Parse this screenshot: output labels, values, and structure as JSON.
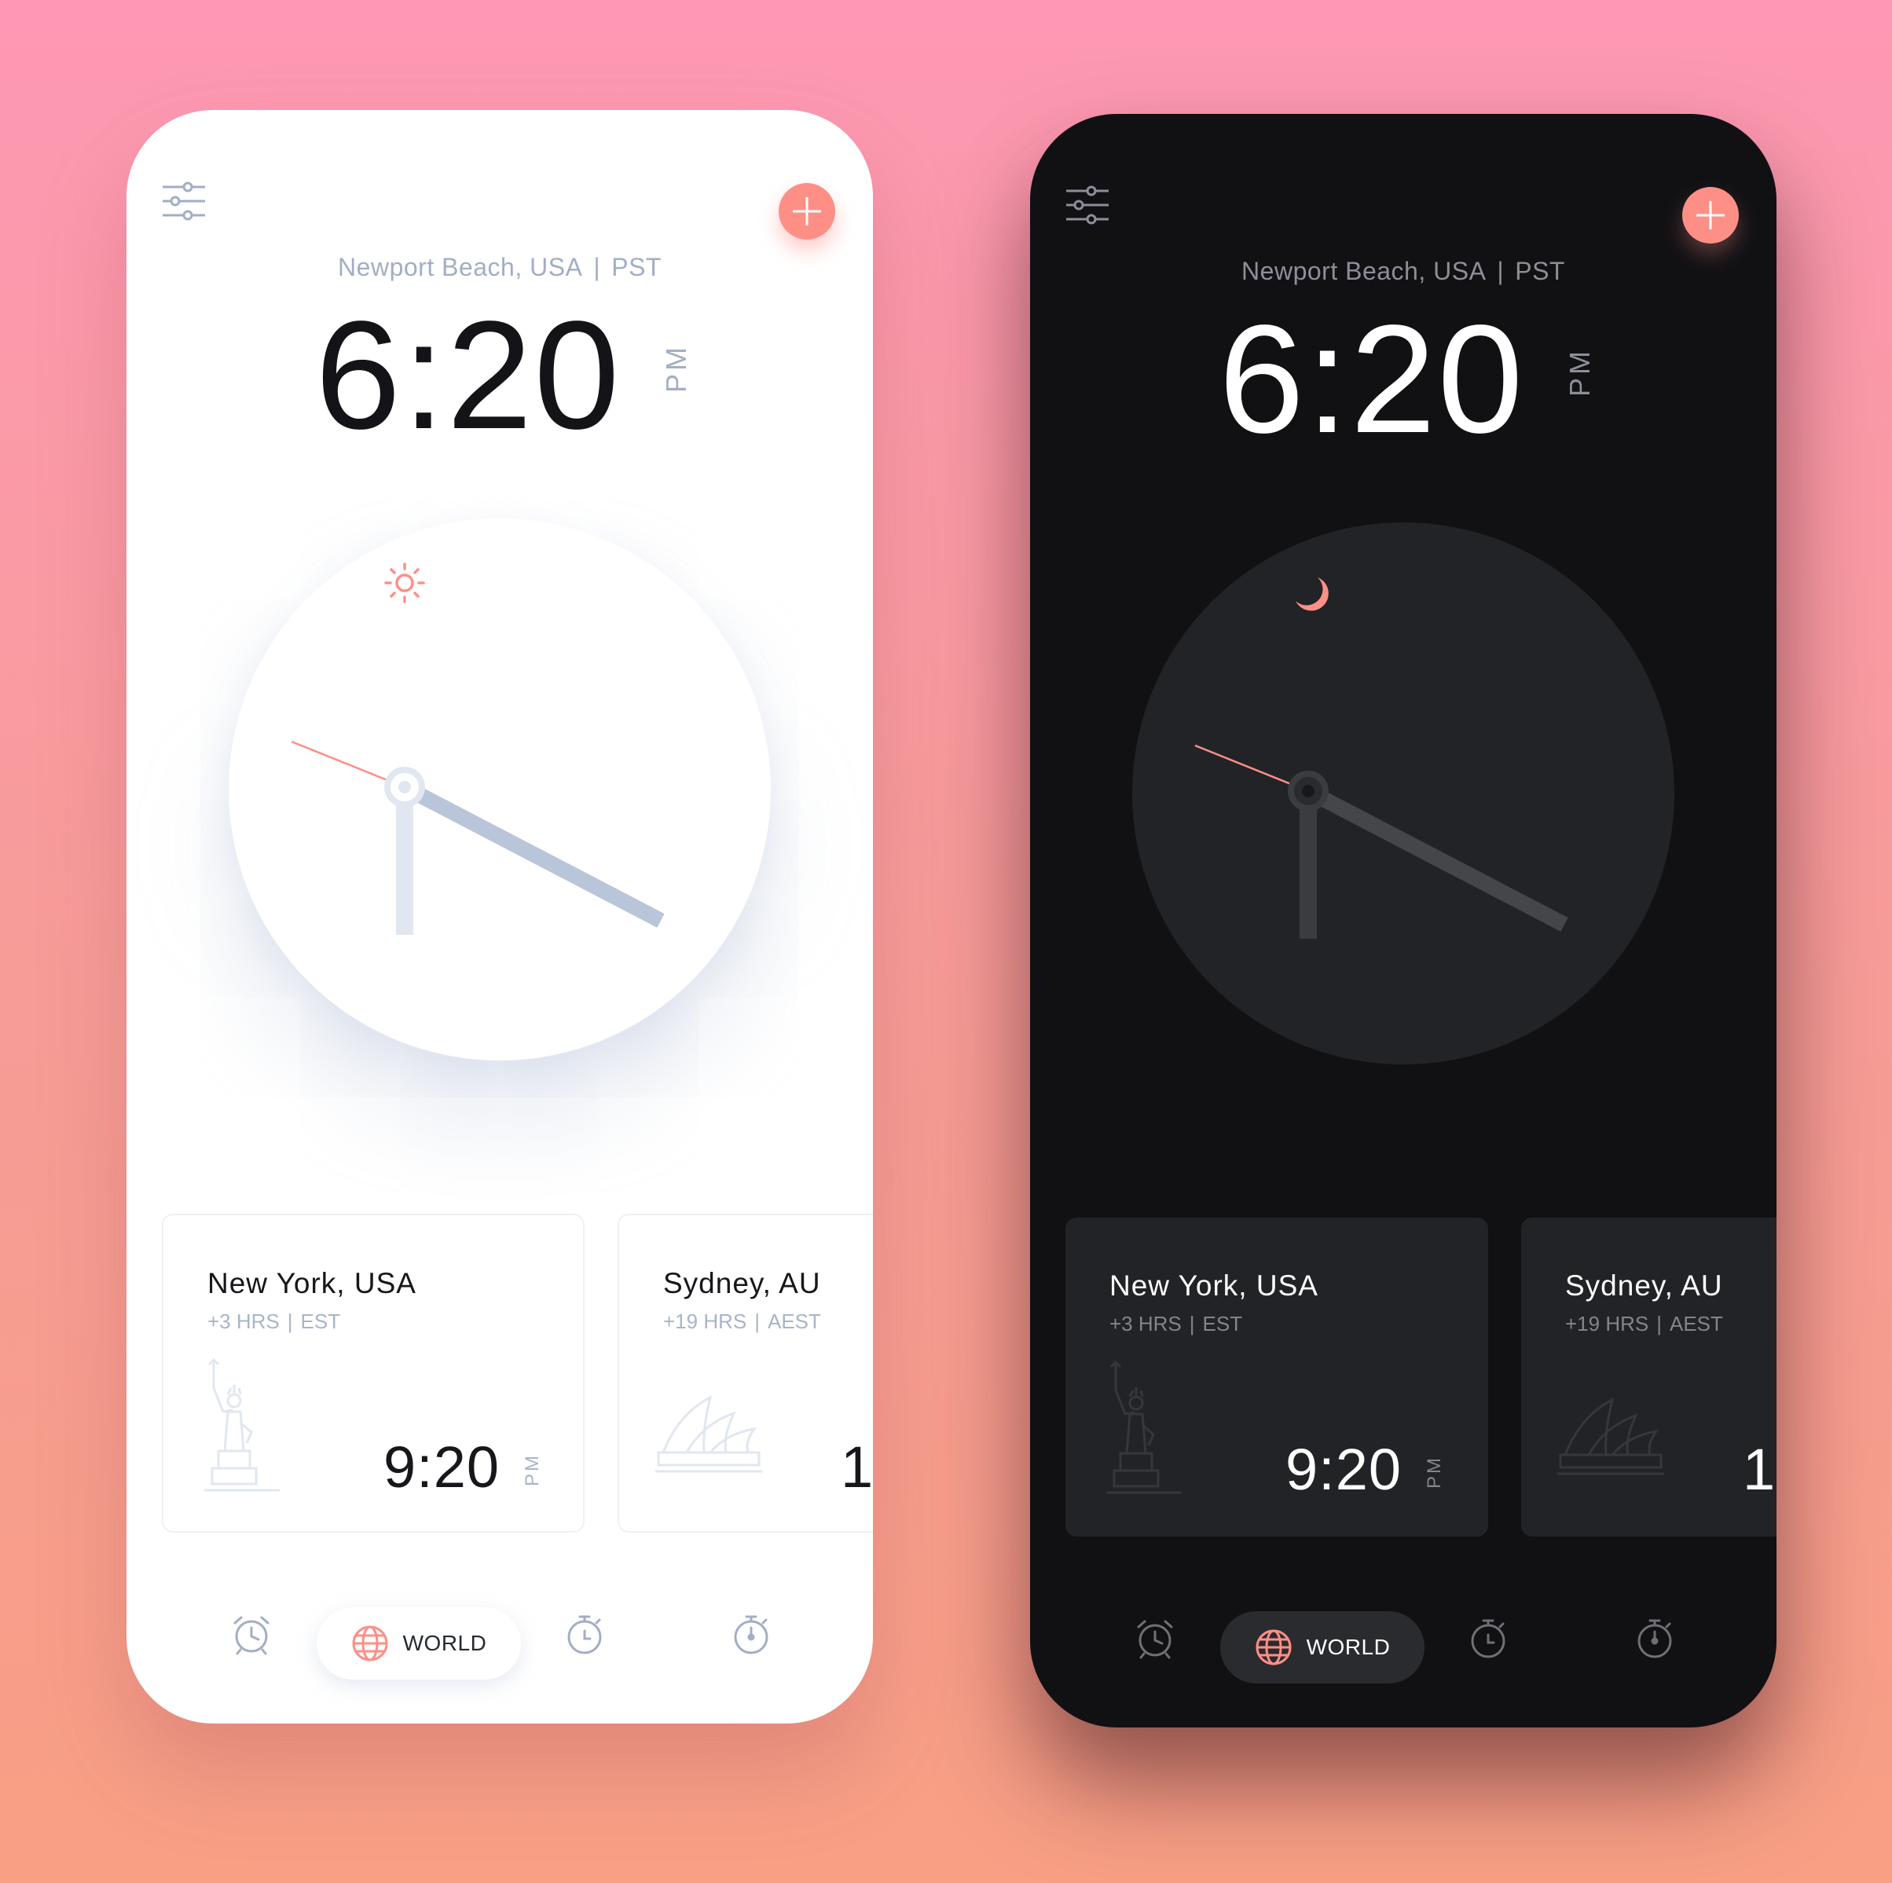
{
  "colors": {
    "accent": "#fe8f87",
    "light_icon": "#a2aec4",
    "dark_icon": "#6f7077"
  },
  "screens": [
    {
      "theme": "light",
      "location": "Newport Beach, USA",
      "timezone": "PST",
      "separator": "|",
      "time": "6:20",
      "ampm": "PM",
      "period_icon": "sun-icon",
      "cards": [
        {
          "city": "New York, USA",
          "offset": "+3 HRS",
          "zone": "EST",
          "time": "9:20",
          "ampm": "PM",
          "landmark_icon": "statue-of-liberty-icon"
        },
        {
          "city": "Sydney, AU",
          "offset": "+19 HRS",
          "zone": "AEST",
          "time": "1",
          "landmark_icon": "sydney-opera-house-icon"
        }
      ],
      "nav": {
        "world_label": "WORLD"
      }
    },
    {
      "theme": "dark",
      "location": "Newport Beach, USA",
      "timezone": "PST",
      "separator": "|",
      "time": "6:20",
      "ampm": "PM",
      "period_icon": "moon-icon",
      "cards": [
        {
          "city": "New York, USA",
          "offset": "+3 HRS",
          "zone": "EST",
          "time": "9:20",
          "ampm": "PM",
          "landmark_icon": "statue-of-liberty-icon"
        },
        {
          "city": "Sydney, AU",
          "offset": "+19 HRS",
          "zone": "AEST",
          "time": "1",
          "landmark_icon": "sydney-opera-house-icon"
        }
      ],
      "nav": {
        "world_label": "WORLD"
      }
    }
  ]
}
